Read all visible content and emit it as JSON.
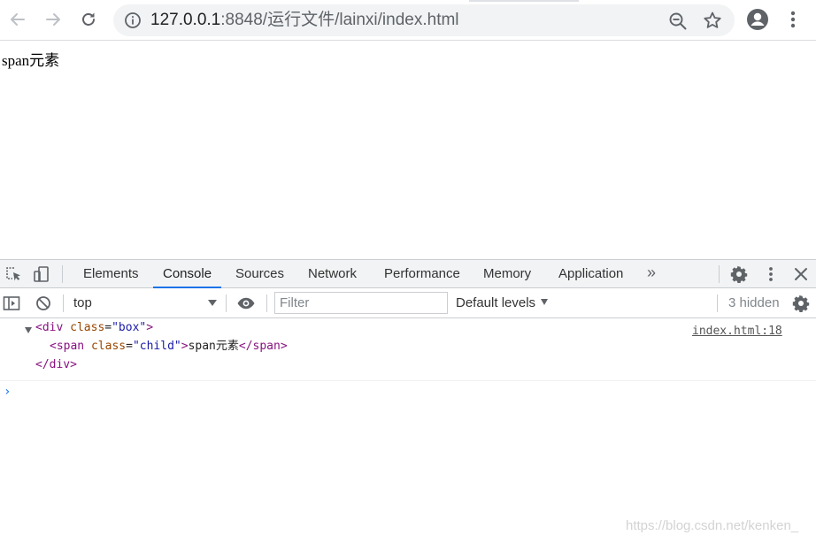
{
  "browser": {
    "url_host": "127.0.0.1",
    "url_rest": ":8848/运行文件/lainxi/index.html"
  },
  "page": {
    "span_text": "span元素"
  },
  "devtools": {
    "tabs": [
      {
        "label": "Elements",
        "active": false
      },
      {
        "label": "Console",
        "active": true
      },
      {
        "label": "Sources",
        "active": false
      },
      {
        "label": "Network",
        "active": false
      },
      {
        "label": "Performance",
        "active": false
      },
      {
        "label": "Memory",
        "active": false
      },
      {
        "label": "Application",
        "active": false
      }
    ],
    "more_tabs": "»",
    "console_bar": {
      "context": "top",
      "filter_placeholder": "Filter",
      "levels": "Default levels",
      "hidden": "3 hidden"
    },
    "message": {
      "source": "index.html:18",
      "line1": {
        "open": "<div",
        "attr": "class",
        "eq": "=",
        "val": "\"box\"",
        "close": ">"
      },
      "line2": {
        "open": "<span",
        "attr": "class",
        "eq": "=",
        "val": "\"child\"",
        "close": ">",
        "text": "span元素",
        "end": "</span>"
      },
      "line3": {
        "end": "</div>"
      }
    },
    "prompt": "›"
  },
  "watermark": "https://blog.csdn.net/kenken_",
  "colors": {
    "accent": "#1a73e8",
    "tag": "#881280",
    "attr_name": "#994500",
    "attr_value": "#1a1aa6"
  }
}
